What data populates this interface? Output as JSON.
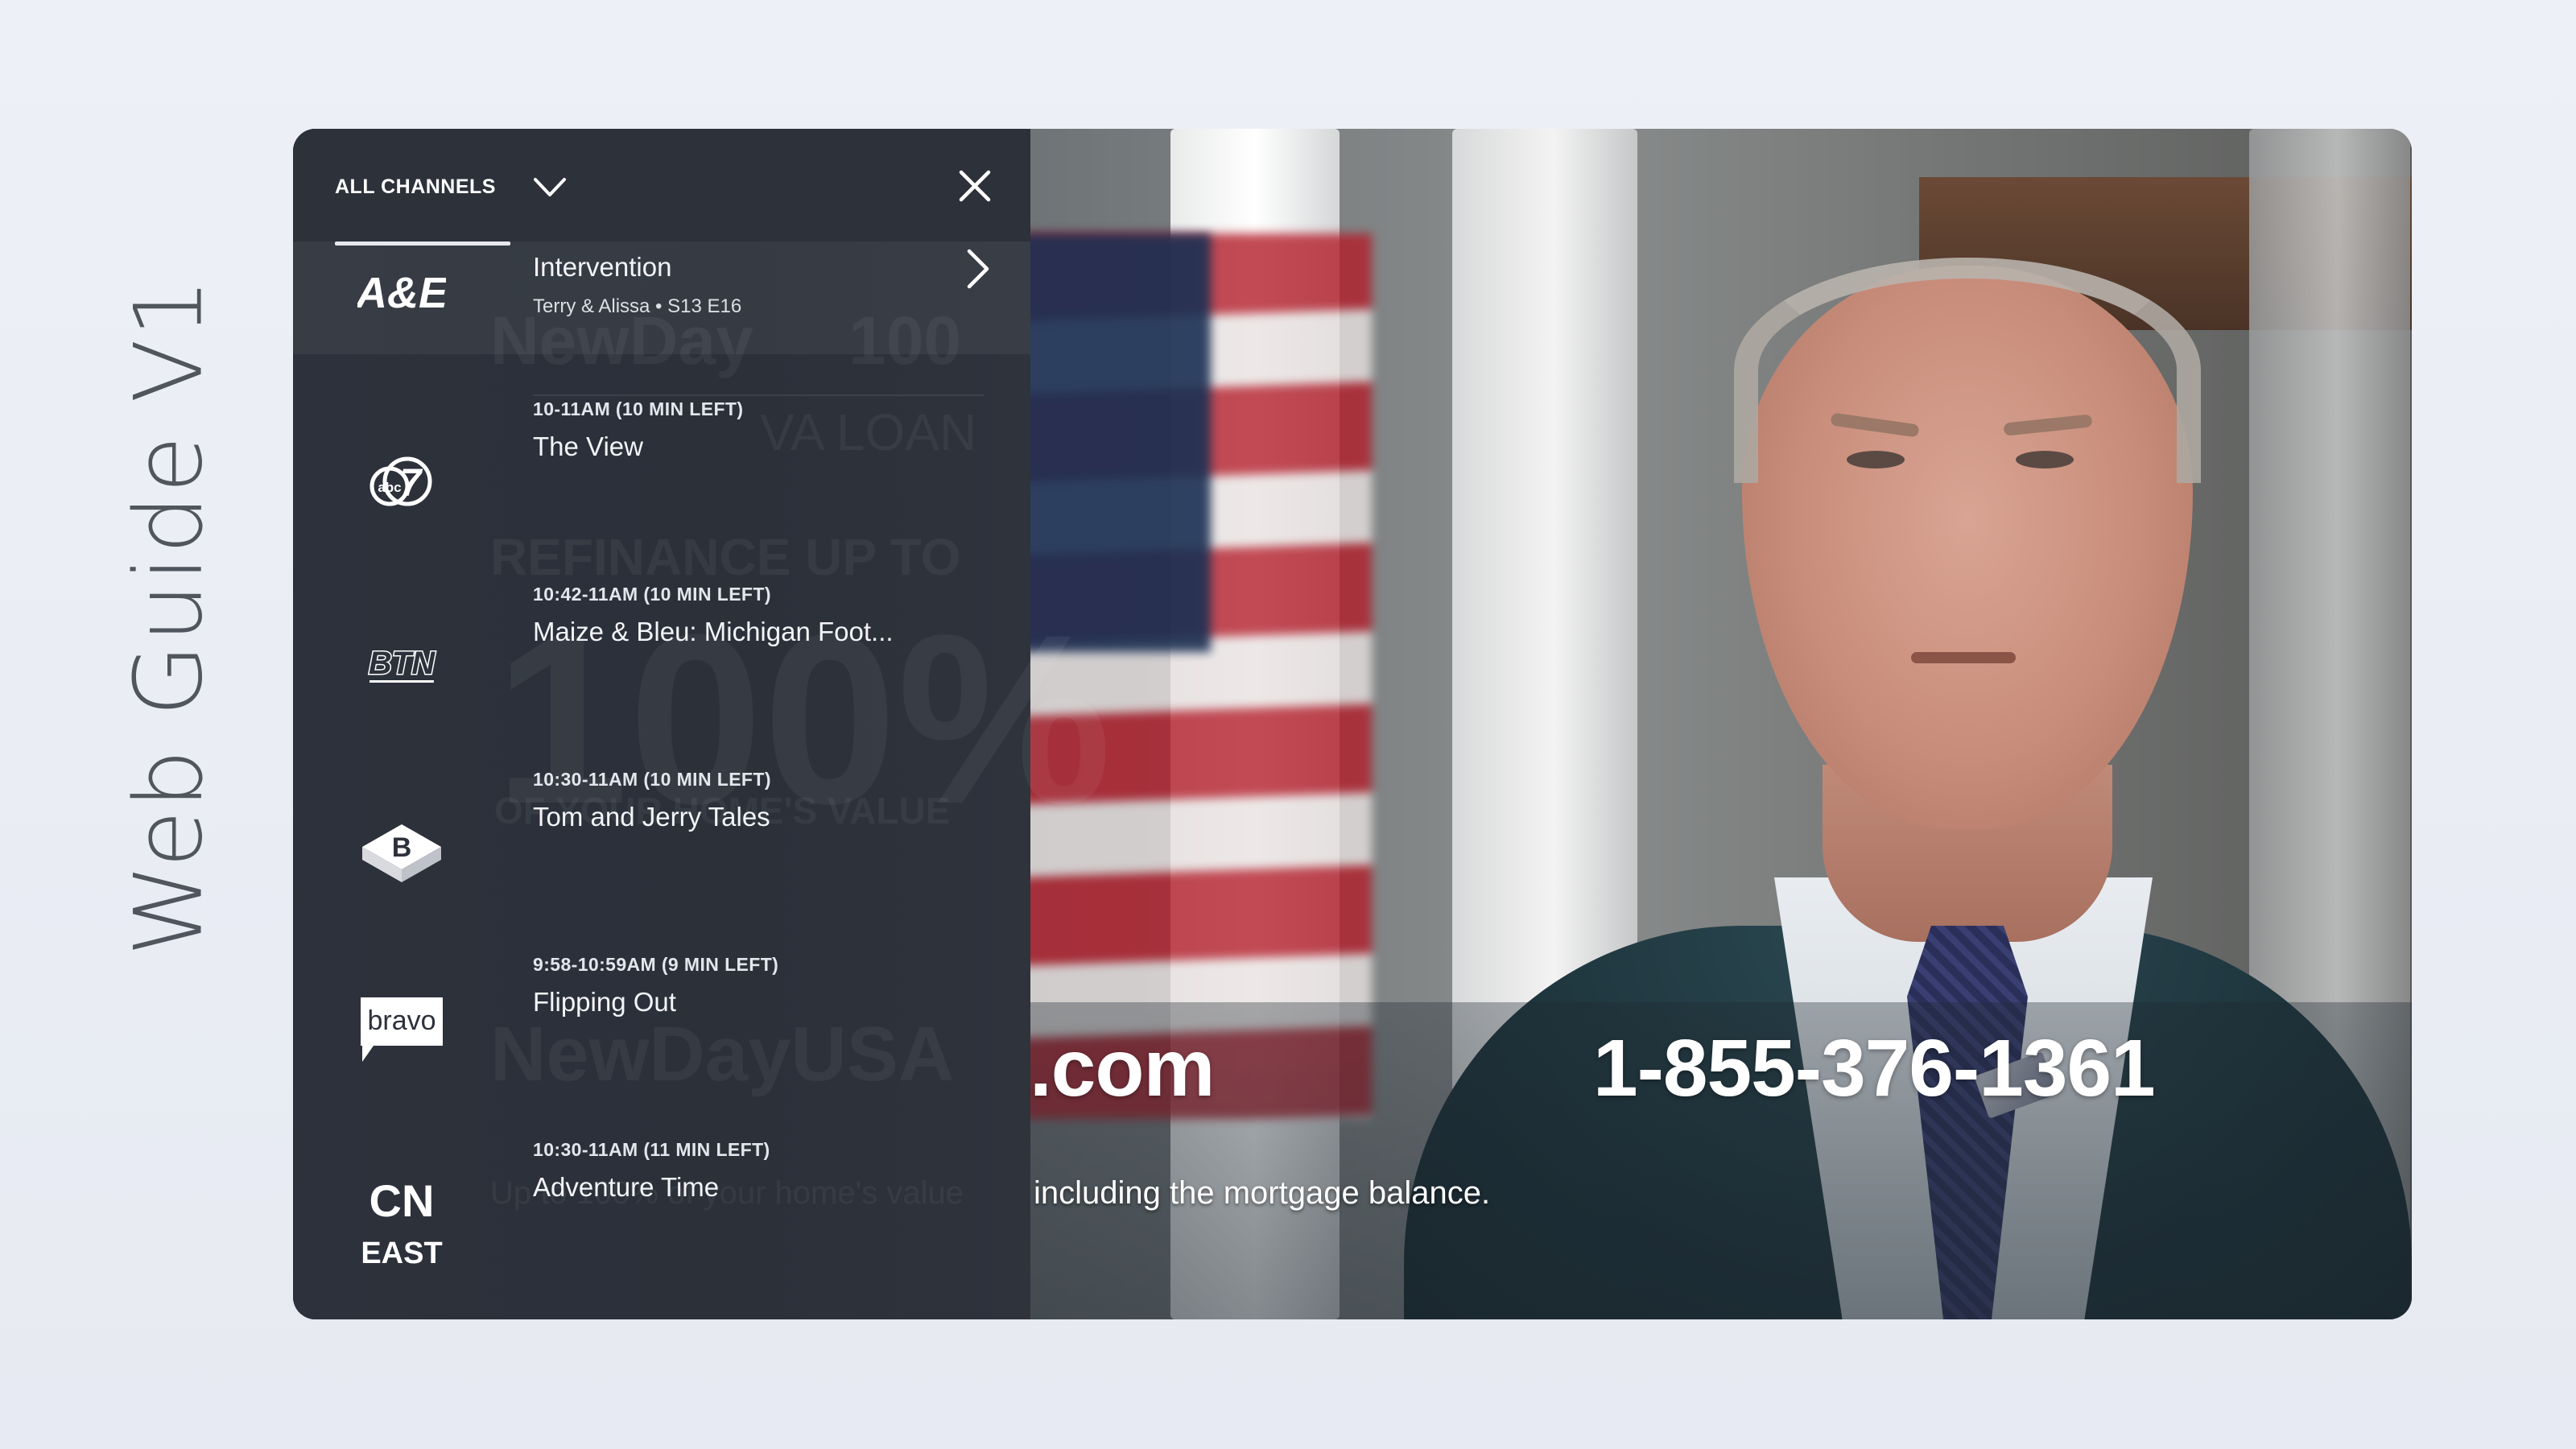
{
  "page_title": "Web Guide V1",
  "guide": {
    "filter_label": "ALL CHANNELS",
    "selected": {
      "channel": "A&E",
      "logo_text": "A&E",
      "title": "Intervention",
      "subtitle": "Terry & Alissa • S13 E16"
    },
    "channels": [
      {
        "channel": "abc 7",
        "logo_text": "abc7",
        "time": "10-11AM (10 MIN LEFT)",
        "title": "The View"
      },
      {
        "channel": "BTN",
        "logo_text": "BTN",
        "time": "10:42-11AM (10 MIN LEFT)",
        "title": "Maize & Bleu: Michigan Foot..."
      },
      {
        "channel": "Boomerang",
        "logo_text": "B",
        "time": "10:30-11AM (10 MIN LEFT)",
        "title": "Tom and Jerry Tales"
      },
      {
        "channel": "Bravo",
        "logo_text": "bravo",
        "time": "9:58-10:59AM (9 MIN LEFT)",
        "title": "Flipping Out"
      },
      {
        "channel": "Cartoon Network East",
        "logo_text": "CN",
        "logo_sub": "EAST",
        "time": "10:30-11AM (11 MIN LEFT)",
        "title": "Adventure Time"
      }
    ],
    "background_ad_text": {
      "line1": "NewDay",
      "line1b": "100",
      "line2": "VA LOAN",
      "line3": "REFINANCE UP TO",
      "line4": "100%",
      "line5": "OF YOUR HOME'S VALUE",
      "line6": "NewDayUSA",
      "line7": "Up to 100% of your home's value"
    }
  },
  "video": {
    "url_text": ".com",
    "phone_text": "1-855-376-1361",
    "caption": "including the mortgage balance."
  },
  "colors": {
    "page_bg": "#edf0f6",
    "guide_bg": "#2c313b",
    "text_primary": "#f3f4f7",
    "accent_underline": "#e6e8ee"
  }
}
